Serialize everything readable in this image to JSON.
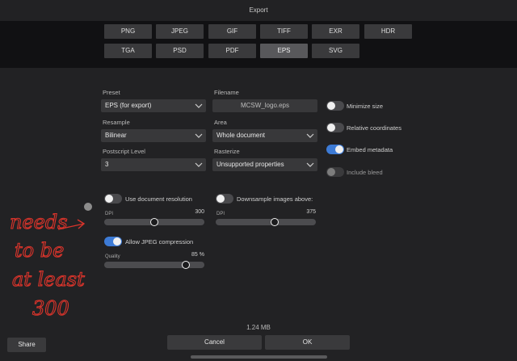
{
  "window": {
    "title": "Export"
  },
  "formats": {
    "row1": [
      "PNG",
      "JPEG",
      "GIF",
      "TIFF",
      "EXR",
      "HDR"
    ],
    "row2": [
      "TGA",
      "PSD",
      "PDF",
      "EPS",
      "SVG"
    ],
    "selected": "EPS"
  },
  "preset": {
    "label": "Preset",
    "value": "EPS (for export)"
  },
  "filename": {
    "label": "Filename",
    "value": "MCSW_logo.eps"
  },
  "resample": {
    "label": "Resample",
    "value": "Bilinear"
  },
  "area": {
    "label": "Area",
    "value": "Whole document"
  },
  "postscript": {
    "label": "Postscript Level",
    "value": "3"
  },
  "rasterize": {
    "label": "Rasterize",
    "value": "Unsupported properties"
  },
  "options": {
    "minimize_size": {
      "label": "Minimize size",
      "on": false
    },
    "relative_coordinates": {
      "label": "Relative coordinates",
      "on": false
    },
    "embed_metadata": {
      "label": "Embed metadata",
      "on": true
    },
    "include_bleed": {
      "label": "Include bleed",
      "on": false,
      "disabled": true
    }
  },
  "use_doc_resolution": {
    "label": "Use document resolution",
    "on": false
  },
  "dpi": {
    "label": "DPI",
    "value": "300",
    "fraction": 0.5
  },
  "downsample": {
    "label": "Downsample images above:",
    "on": false
  },
  "downsample_dpi": {
    "label": "DPI",
    "value": "375",
    "fraction": 0.6
  },
  "jpeg": {
    "label": "Allow JPEG compression",
    "on": true
  },
  "quality": {
    "label": "Quality",
    "value": "85 %",
    "fraction": 0.85
  },
  "annotation": {
    "text": "needs to be at least 300",
    "color": "#d9342b"
  },
  "footer": {
    "file_size": "1.24 MB",
    "share": "Share",
    "cancel": "Cancel",
    "ok": "OK"
  },
  "colors": {
    "accent": "#3d7bd6",
    "background": "#222224",
    "format_bar": "#111113"
  }
}
